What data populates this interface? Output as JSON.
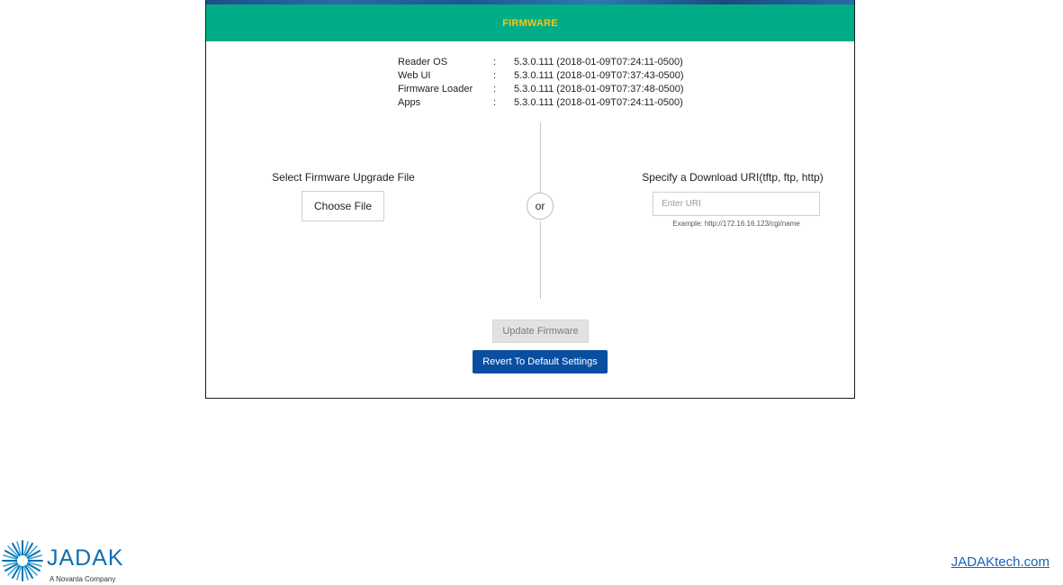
{
  "header": {
    "title": "FIRMWARE"
  },
  "versions": [
    {
      "label": "Reader OS",
      "separator": ":",
      "value": "5.3.0.111 (2018-01-09T07:24:11-0500)"
    },
    {
      "label": "Web UI",
      "separator": ":",
      "value": "5.3.0.111 (2018-01-09T07:37:43-0500)"
    },
    {
      "label": "Firmware Loader",
      "separator": ":",
      "value": "5.3.0.111 (2018-01-09T07:37:48-0500)"
    },
    {
      "label": "Apps",
      "separator": ":",
      "value": "5.3.0.111 (2018-01-09T07:24:11-0500)"
    }
  ],
  "upload": {
    "label": "Select Firmware Upgrade File",
    "button_label": "Choose File"
  },
  "divider": {
    "or_label": "or"
  },
  "uri": {
    "label": "Specify a Download URI(tftp, ftp, http)",
    "placeholder": "Enter URI",
    "value": "",
    "example": "Example: http://172.16.16.123/cgi/name"
  },
  "actions": {
    "update_label": "Update Firmware",
    "revert_label": "Revert To Default Settings"
  },
  "footer": {
    "brand_name": "JADAK",
    "brand_tagline": "A Novanta Company",
    "site_link": "JADAKtech.com"
  },
  "colors": {
    "header_bg": "#00ad86",
    "header_text": "#f5c518",
    "primary_button": "#0a4ea2",
    "brand_blue": "#0f6fb0"
  },
  "icons": {
    "logo": "starburst-logo-icon"
  }
}
